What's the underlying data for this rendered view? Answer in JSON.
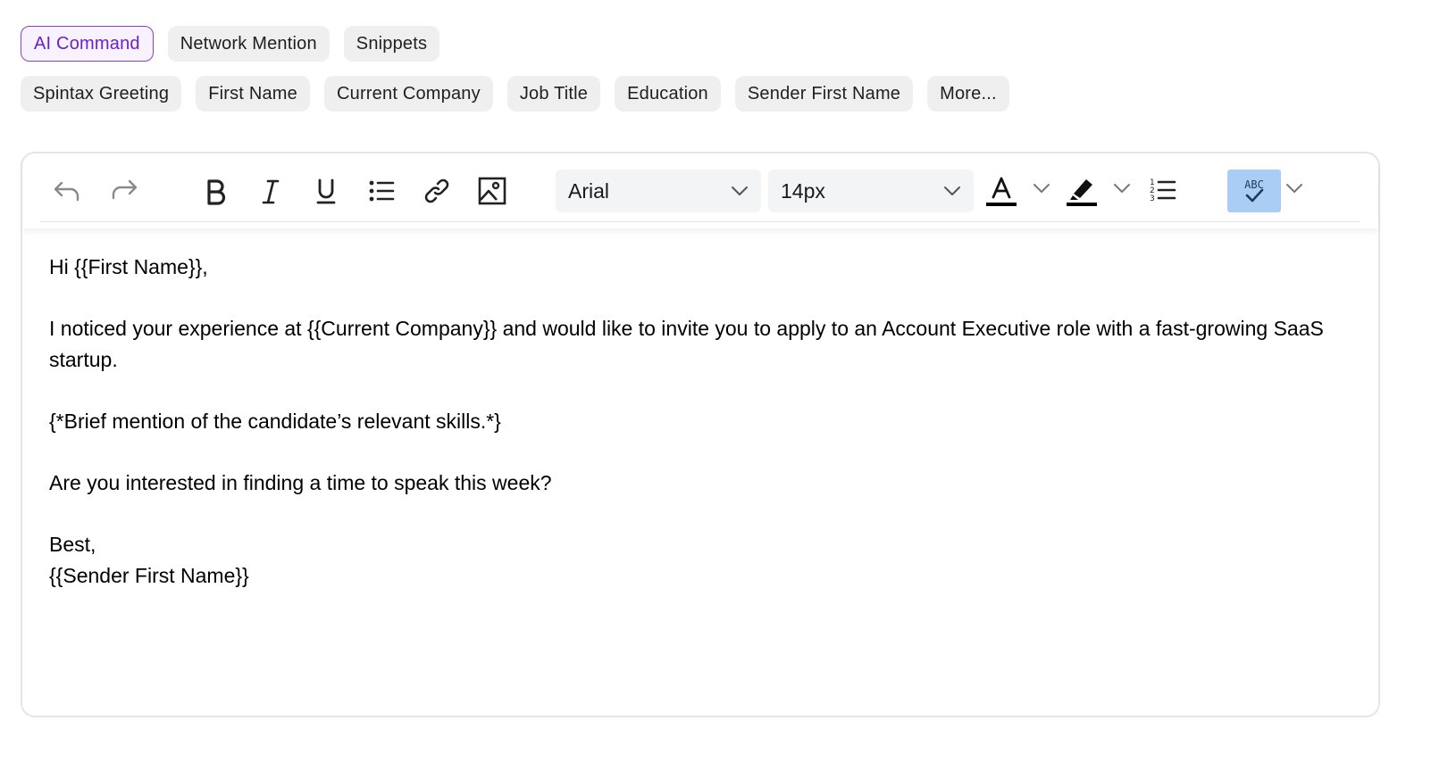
{
  "chips_row1": [
    "AI Command",
    "Network Mention",
    "Snippets"
  ],
  "chips_row2": [
    "Spintax Greeting",
    "First Name",
    "Current Company",
    "Job Title",
    "Education",
    "Sender First Name",
    "More..."
  ],
  "toolbar": {
    "font_family": "Arial",
    "font_size": "14px",
    "spellcheck_label": "ABC"
  },
  "body": {
    "greeting": "Hi {{First Name}},",
    "paragraph1": "I noticed your experience at {{Current Company}} and would like to invite you to apply to an Account Executive role with a fast-growing SaaS startup.",
    "paragraph2": "{*Brief mention of the candidate’s relevant skills.*}",
    "paragraph3": "Are you interested in finding a time to speak this week?",
    "signoff": "Best,",
    "signature": "{{Sender First Name}}"
  },
  "colors": {
    "accent_purple": "#6b21c8",
    "spellcheck_active": "#a9cdf5"
  }
}
